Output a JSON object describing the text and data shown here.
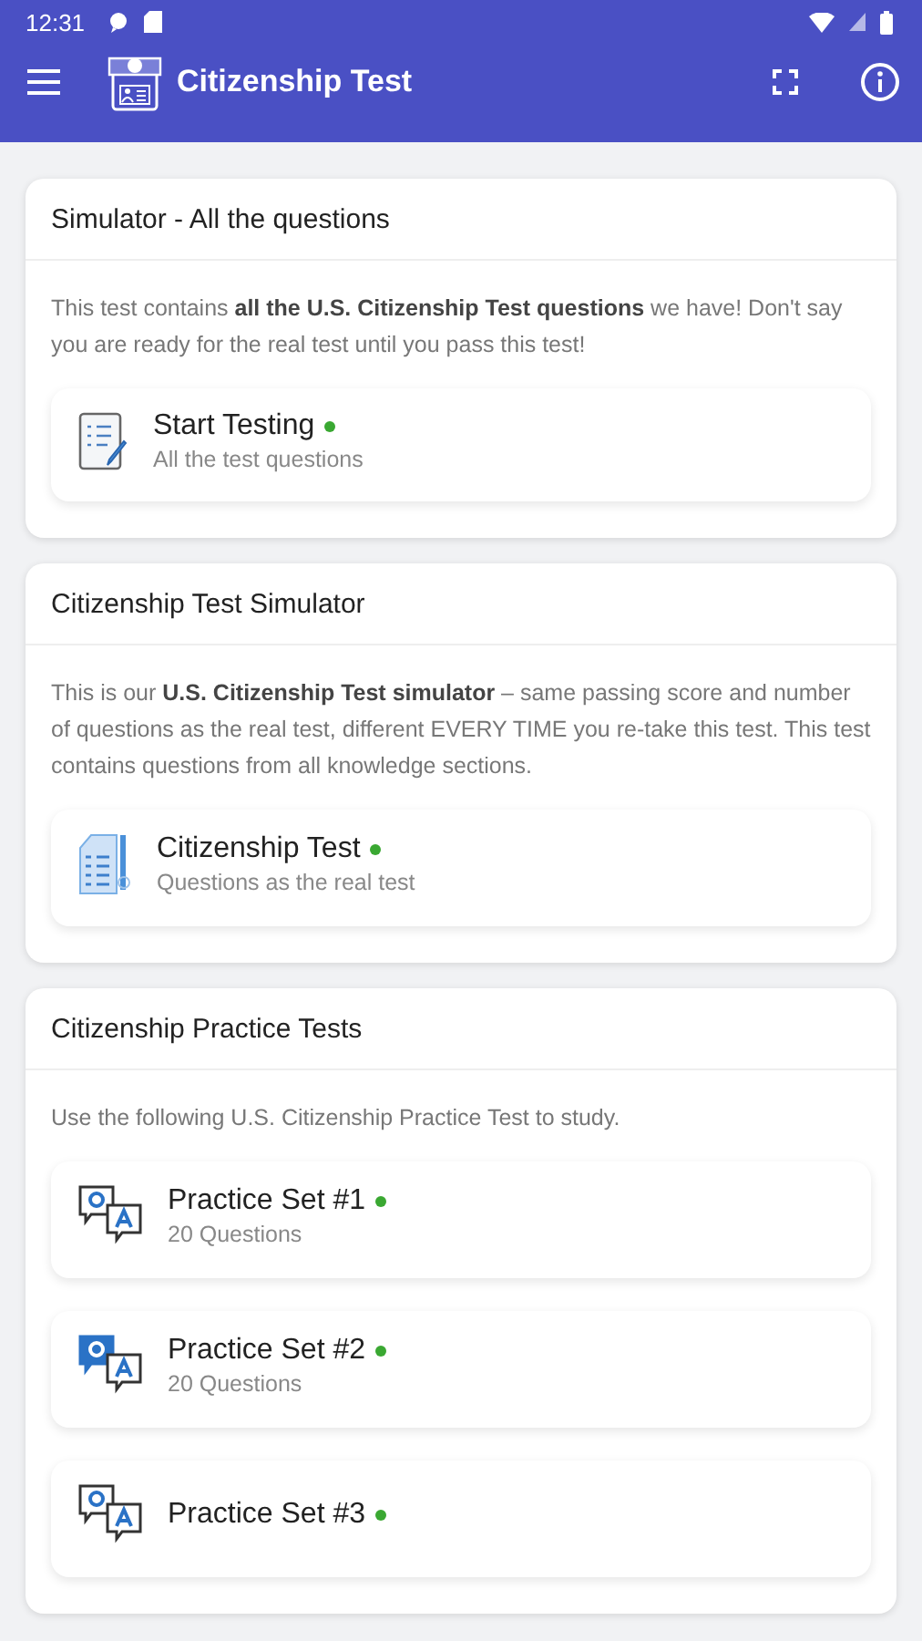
{
  "status_bar": {
    "time": "12:31"
  },
  "app_bar": {
    "title": "Citizenship Test"
  },
  "sections": [
    {
      "title": "Simulator - All the questions",
      "description": "This test contains **all the U.S. Citizenship Test questions** we have! Don't say you are ready for the real test until you pass this test!",
      "items": [
        {
          "kind": "checklist",
          "title": "Start Testing",
          "subtitle": "All the test questions",
          "color": "#3aa832"
        }
      ]
    },
    {
      "title": "Citizenship Test Simulator",
      "description": "This is our **U.S. Citizenship Test simulator** – same passing score and number of questions as the real test, different EVERY TIME you re-take this test. This test contains questions from all knowledge sections.",
      "items": [
        {
          "kind": "document",
          "title": "Citizenship Test",
          "subtitle": "Questions as the real test",
          "color": "#3aa832"
        }
      ]
    },
    {
      "title": "Citizenship Practice Tests",
      "description": "Use the following U.S. Citizenship Practice Test to study.",
      "items": [
        {
          "kind": "qa",
          "title": "Practice Set #1",
          "subtitle": "20 Questions",
          "color": "#3aa832"
        },
        {
          "kind": "qa-filled",
          "title": "Practice Set #2",
          "subtitle": "20 Questions",
          "color": "#3aa832"
        },
        {
          "kind": "qa",
          "title": "Practice Set #3",
          "color": "#3aa832"
        }
      ]
    }
  ]
}
